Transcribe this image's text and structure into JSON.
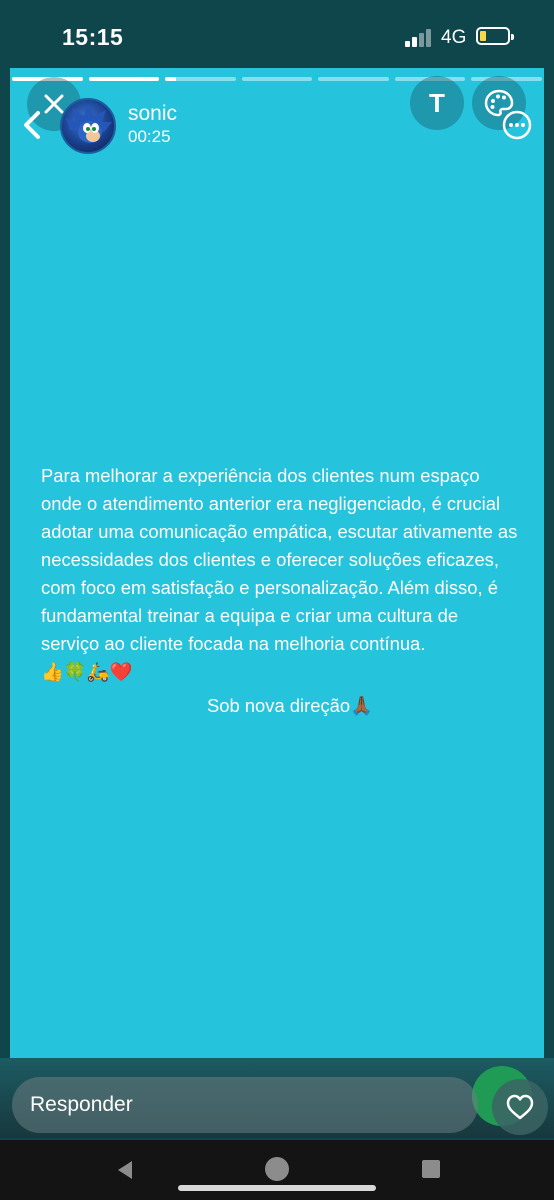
{
  "status_bar": {
    "time": "15:15",
    "network": "4G",
    "battery_color": "#f5d94a"
  },
  "story": {
    "background_color": "#26c3dd",
    "progress": [
      1,
      1,
      0.15,
      0,
      0,
      0,
      0
    ],
    "user": {
      "name": "sonic",
      "elapsed": "00:25"
    },
    "tools": {
      "text_tool_label": "T"
    },
    "caption": {
      "body": "Para melhorar a experiência dos clientes num espaço onde o atendimento anterior era negligenciado, é crucial adotar uma comunicação empática, escutar ativamente as necessidades dos clientes e oferecer soluções eficazes, com foco em satisfação e personalização. Além disso, é fundamental treinar a equipa e criar uma cultura de serviço ao cliente focada na melhoria contínua.",
      "emojis": "👍🍀🛵❤️",
      "signature": "Sob nova direção🙏🏾"
    }
  },
  "reply": {
    "placeholder": "Responder"
  },
  "icons": {
    "back": "chevron-left-icon",
    "close": "close-icon",
    "text": "text-tool-icon",
    "palette": "palette-icon",
    "more": "more-options-icon",
    "heart": "heart-icon"
  }
}
